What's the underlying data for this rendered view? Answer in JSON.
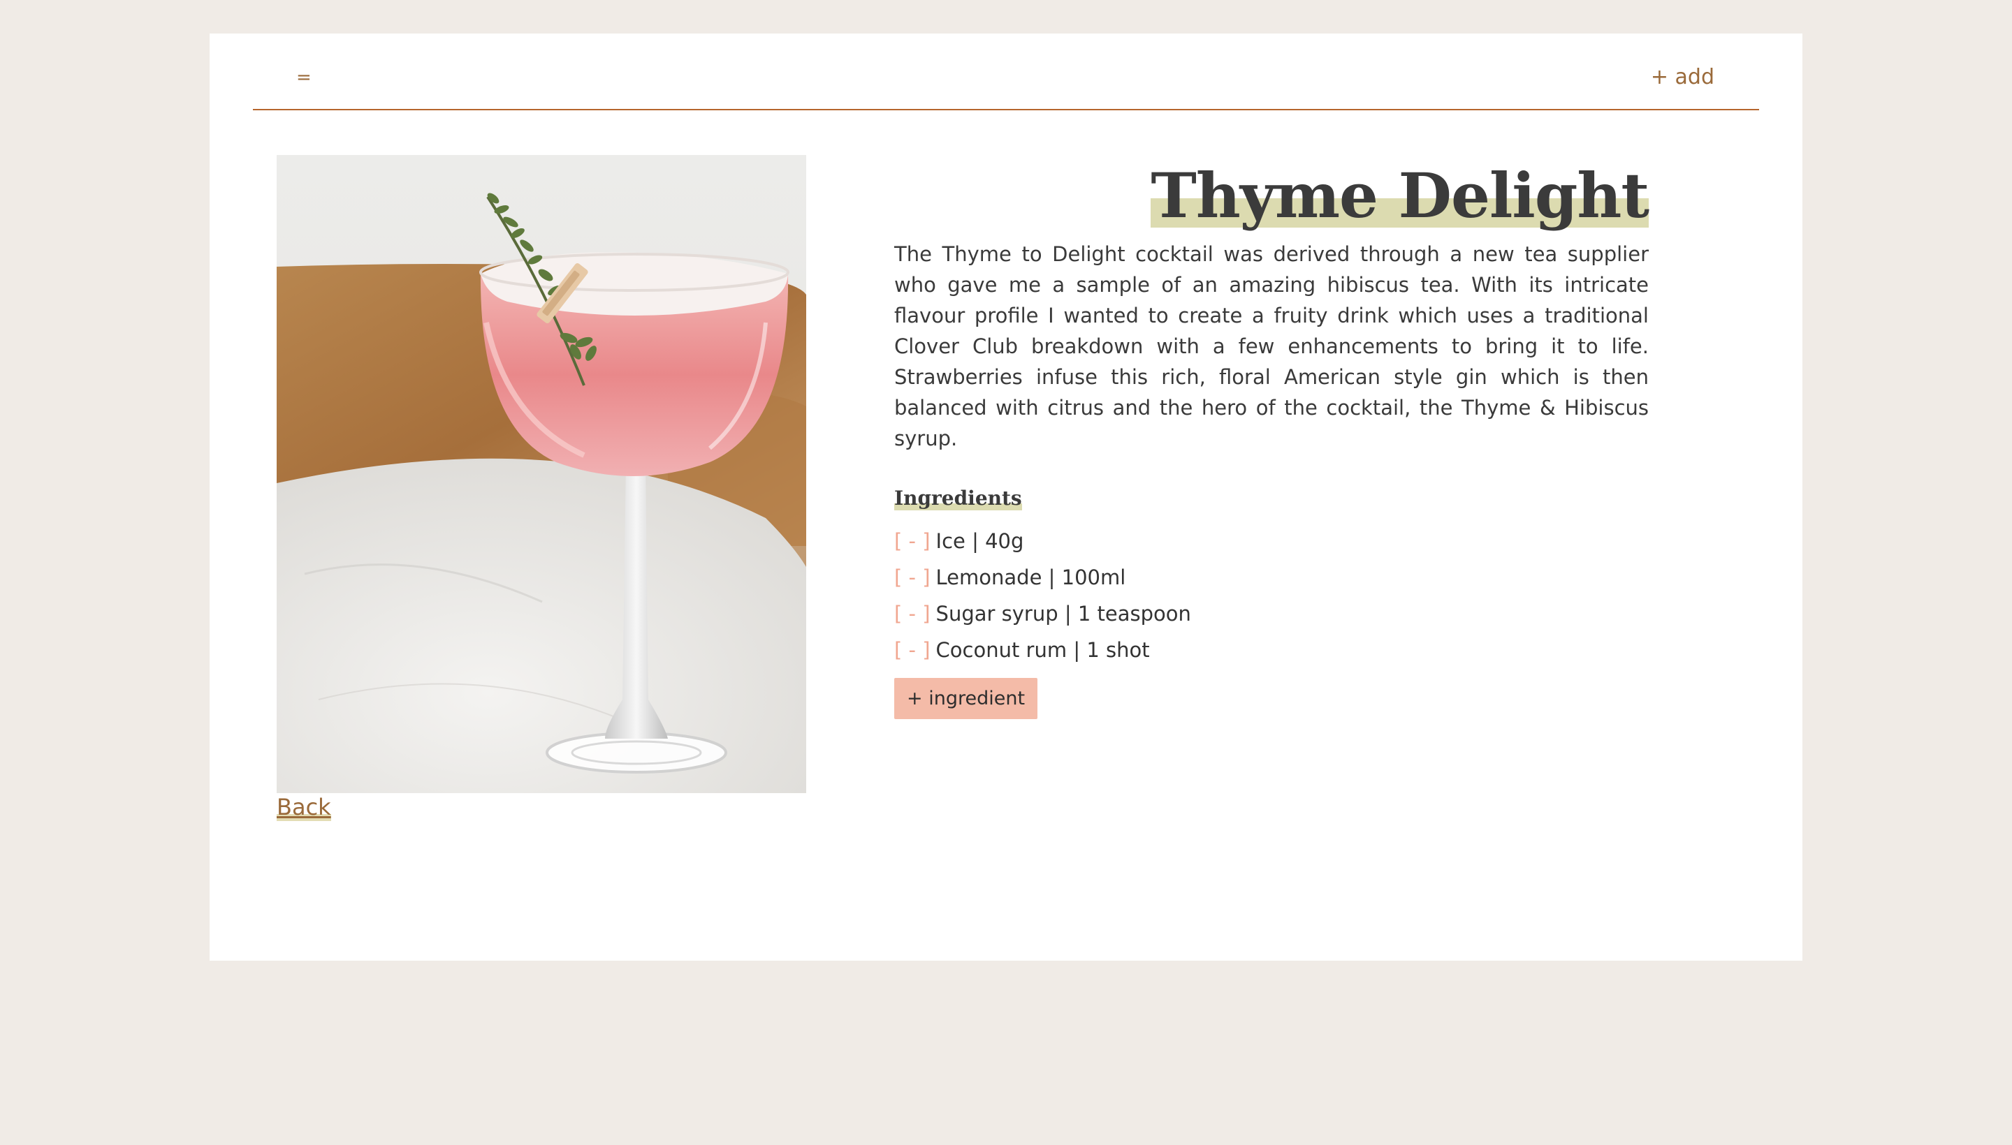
{
  "nav": {
    "menu_label": "=",
    "add_label": "+ add"
  },
  "recipe": {
    "title": "Thyme Delight",
    "description": "The Thyme to Delight cocktail was derived through a new tea supplier who gave me a sample of an amazing hibiscus tea. With its intricate flavour profile I wanted to create a fruity drink which uses a traditional Clover Club breakdown with a few enhancements to bring it to life. Strawberries infuse this rich, floral American style gin which is then balanced with citrus and the hero of the cocktail, the Thyme & Hibiscus syrup.",
    "ingredients_heading": "Ingredients",
    "remove_label": "[ - ]",
    "ingredients": [
      {
        "text": "Ice | 40g"
      },
      {
        "text": "Lemonade | 100ml"
      },
      {
        "text": "Sugar syrup | 1 teaspoon"
      },
      {
        "text": "Coconut rum | 1 shot"
      }
    ],
    "add_ingredient_label": "+ ingredient",
    "back_label": "Back"
  },
  "colors": {
    "background": "#f0ebe6",
    "card": "#ffffff",
    "accent": "#9a6a3a",
    "rule": "#b5652d",
    "highlight": "#dcdbb0",
    "button": "#f4bba8",
    "remove": "#f0a690"
  },
  "image": {
    "subject": "pink cocktail in a coupe glass with thyme garnish"
  }
}
